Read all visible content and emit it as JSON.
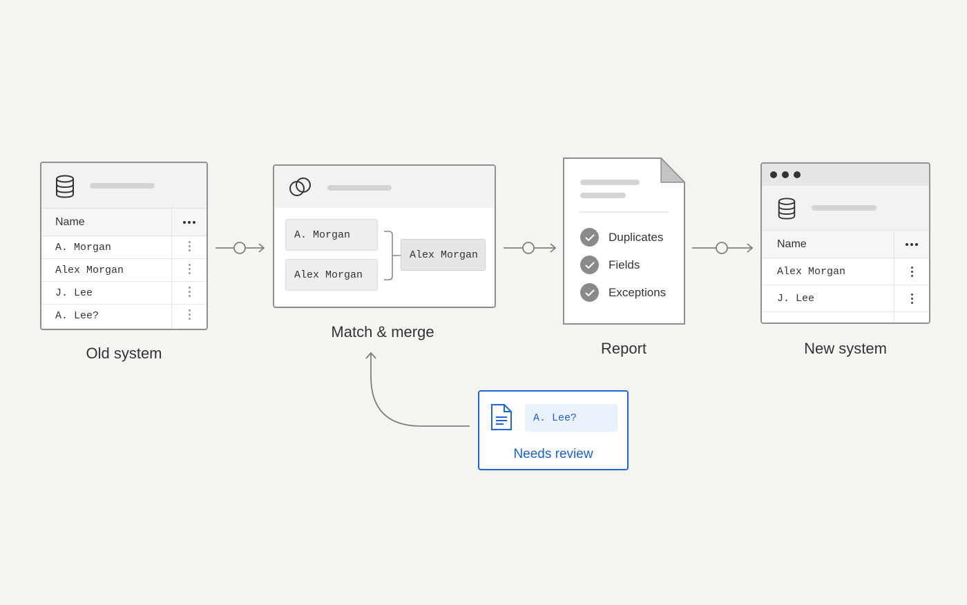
{
  "old_system": {
    "column_header": "Name",
    "rows": [
      "A. Morgan",
      "Alex Morgan",
      "J. Lee",
      "A. Lee?"
    ],
    "caption": "Old system"
  },
  "match_merge": {
    "inputs": [
      "A. Morgan",
      "Alex Morgan"
    ],
    "result": "Alex Morgan",
    "caption": "Match & merge"
  },
  "report": {
    "checks": [
      "Duplicates",
      "Fields",
      "Exceptions"
    ],
    "caption": "Report"
  },
  "new_system": {
    "column_header": "Name",
    "rows": [
      "Alex Morgan",
      "J. Lee"
    ],
    "caption": "New system"
  },
  "review": {
    "record": "A. Lee?",
    "label": "Needs review"
  },
  "colors": {
    "accent": "#1a66d9",
    "border": "#8f8f8f",
    "check": "#8a8a8a",
    "background": "#f5f4f1"
  }
}
